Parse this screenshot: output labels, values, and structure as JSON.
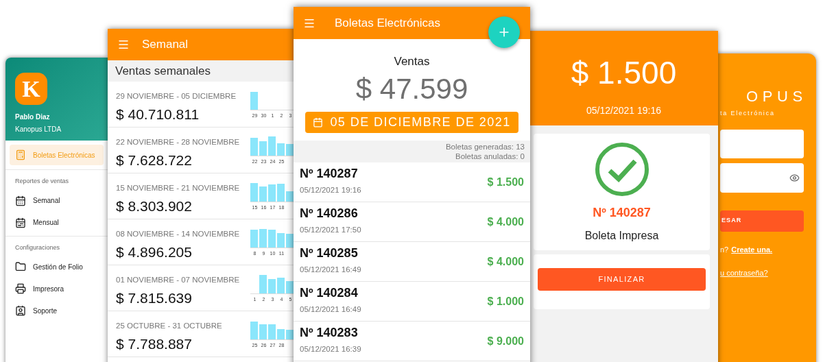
{
  "drawer": {
    "logo": "K",
    "user_name": "Pablo Diaz",
    "company": "Kanopus LTDA",
    "items": [
      {
        "label": "Boletas Electrónicas",
        "selected": true
      }
    ],
    "sections": [
      {
        "title": "Reportes de ventas",
        "items": [
          {
            "label": "Semanal",
            "selected": false
          },
          {
            "label": "Mensual",
            "selected": false
          }
        ]
      },
      {
        "title": "Configuraciones",
        "items": [
          {
            "label": "Gestión de Folio",
            "selected": false
          },
          {
            "label": "Impresora",
            "selected": false
          },
          {
            "label": "Soporte",
            "selected": false
          }
        ]
      }
    ]
  },
  "weekly": {
    "title": "Semanal",
    "subtitle": "Ventas semanales",
    "weeks": [
      {
        "range": "29 NOVIEMBRE - 05 DICIEMBRE",
        "total": "$ 40.710.811",
        "days": [
          "29",
          "30",
          "1",
          "2",
          "3"
        ]
      },
      {
        "range": "22 NOVIEMBRE - 28 NOVIEMBRE",
        "total": "$ 7.628.722",
        "days": [
          "22",
          "23",
          "24",
          "25"
        ]
      },
      {
        "range": "15 NOVIEMBRE - 21 NOVIEMBRE",
        "total": "$ 8.303.902",
        "days": [
          "15",
          "16",
          "17",
          "18"
        ]
      },
      {
        "range": "08 NOVIEMBRE - 14 NOVIEMBRE",
        "total": "$ 4.896.205",
        "days": [
          "8",
          "9",
          "10",
          "11"
        ]
      },
      {
        "range": "01 NOVIEMBRE - 07 NOVIEMBRE",
        "total": "$ 7.815.639",
        "days": [
          "1",
          "2",
          "3",
          "4",
          "5"
        ]
      },
      {
        "range": "25 OCTUBRE - 31 OCTUBRE",
        "total": "$ 7.788.887",
        "days": [
          "25",
          "26",
          "27",
          "28"
        ]
      }
    ]
  },
  "receipts": {
    "title": "Boletas Electrónicas",
    "sales_label": "Ventas",
    "sales_total": "$ 47.599",
    "date": "05 DE DICIEMBRE DE 2021",
    "stats": [
      "Boletas generadas: 13",
      "Boletas anuladas: 0"
    ],
    "items": [
      {
        "number": "Nº 140287",
        "datetime": "05/12/2021 19:16",
        "amount": "$ 1.500"
      },
      {
        "number": "Nº 140286",
        "datetime": "05/12/2021 17:50",
        "amount": "$ 4.000"
      },
      {
        "number": "Nº 140285",
        "datetime": "05/12/2021 16:49",
        "amount": "$ 4.000"
      },
      {
        "number": "Nº 140284",
        "datetime": "05/12/2021 16:49",
        "amount": "$ 1.000"
      },
      {
        "number": "Nº 140283",
        "datetime": "05/12/2021 16:39",
        "amount": "$ 9.000"
      }
    ]
  },
  "receipt_detail": {
    "amount": "$ 1.500",
    "datetime": "05/12/2021 19:16",
    "number": "Nº 140287",
    "status": "Boleta Impresa",
    "button": "FINALIZAR"
  },
  "login": {
    "logo": "OPUS",
    "tagline": "ta Electrónica",
    "button": "ESAR",
    "signup_prompt": "n?",
    "signup_link": "Create una.",
    "forgot_link": "u contraseña?"
  }
}
